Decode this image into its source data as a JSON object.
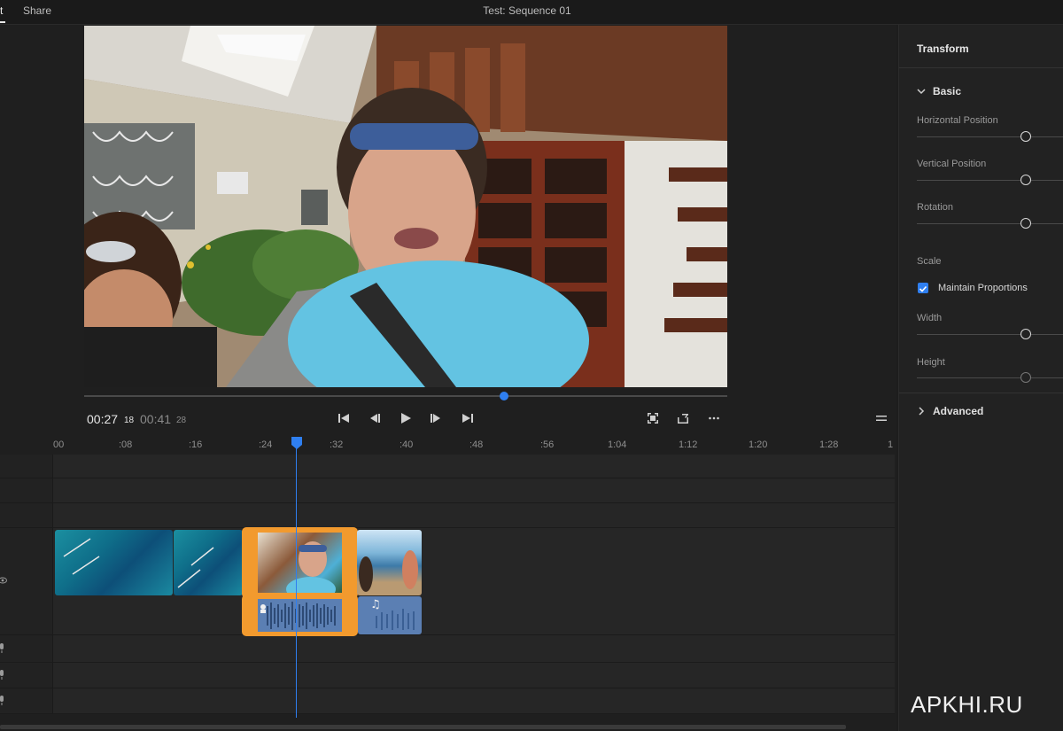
{
  "topbar": {
    "tab_edit": "t",
    "tab_share": "Share",
    "sequence_title": "Test: Sequence 01"
  },
  "viewer": {
    "playback_progress": 0.653
  },
  "timecode": {
    "current": "00:27",
    "current_frames": "18",
    "total": "00:41",
    "total_frames": "28"
  },
  "transport": {
    "icons": [
      "skip-back-icon",
      "step-back-icon",
      "play-icon",
      "step-forward-icon",
      "skip-forward-icon"
    ],
    "right_icons": [
      "fit-frame-icon",
      "export-icon",
      "more-icon",
      "hamburger-menu-icon"
    ]
  },
  "ruler": {
    "labels": [
      "00",
      ":08",
      ":16",
      ":24",
      ":32",
      ":40",
      ":48",
      ":56",
      "1:04",
      "1:12",
      "1:20",
      "1:28",
      "1"
    ]
  },
  "timeline": {
    "audio_note_icon": "♫"
  },
  "properties": {
    "panel_title": "Transform",
    "basic_section": "Basic",
    "horizontal_position": "Horizontal Position",
    "vertical_position": "Vertical Position",
    "rotation": "Rotation",
    "scale": "Scale",
    "maintain_proportions": "Maintain Proportions",
    "width": "Width",
    "height": "Height",
    "advanced_section": "Advanced"
  },
  "colors": {
    "accent_blue": "#2f7ff0",
    "selection_orange": "#f29a2e",
    "audio_clip": "#5b7fb3"
  },
  "watermark": "APKHI.RU"
}
